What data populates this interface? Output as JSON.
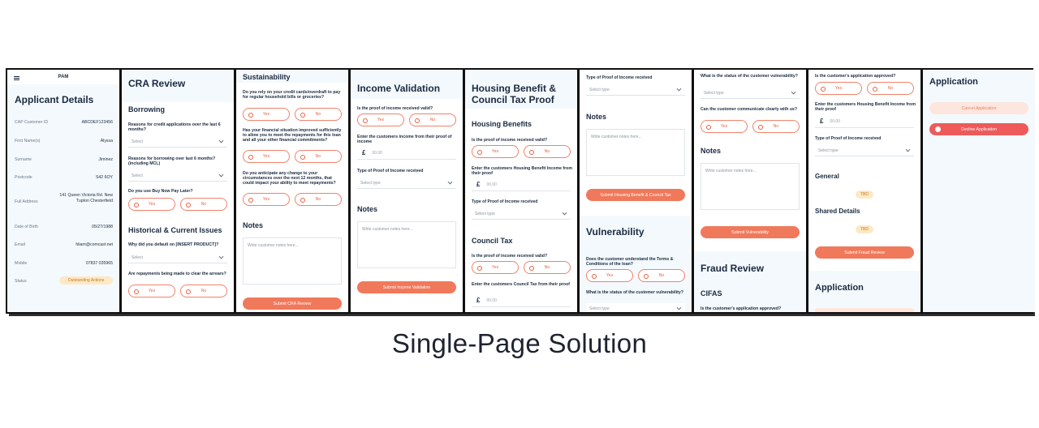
{
  "caption": "Single-Page Solution",
  "panel1": {
    "app_title": "PAM",
    "title": "Applicant Details",
    "rows": [
      {
        "label": "CAP Customer ID",
        "value": "ABCDEF123456"
      },
      {
        "label": "First Name(s)",
        "value": "Alyssa"
      },
      {
        "label": "Surname",
        "value": "Jiminez"
      },
      {
        "label": "Postcode",
        "value": "S42 6OY"
      },
      {
        "label": "Full Address",
        "value": "141 Queen Victoria Rd. New Tupton Chesterfield"
      },
      {
        "label": "Date of Birth",
        "value": "05/27/1988"
      },
      {
        "label": "Email",
        "value": "hliam@comcast.net"
      },
      {
        "label": "Mobile",
        "value": "07837 035965"
      }
    ],
    "status_label": "Status",
    "status_value": "Outstanding Actions"
  },
  "panel2": {
    "title": "CRA Review",
    "section1": "Borrowing",
    "q1": "Reasons for credit applications over the last 6 months?",
    "q1_select": "Select",
    "q2": "Reasons for borrowing over last 6 months? (including MCL)",
    "q2_select": "Select",
    "q3": "Do you use Buy Now Pay Later?",
    "section2": "Historical & Current Issues",
    "q4": "Why did you default on [INSERT PRODUCT]?",
    "q4_select": "Select",
    "q5": "Are repayments being made to clear the arrears?",
    "yes": "Yes",
    "no": "No"
  },
  "panel3": {
    "title": "Sustainability",
    "q1": "Do you rely on your credit cards/overdraft to pay for regular household bills or groceries?",
    "q2": "Has your financial situation improved sufficiently to allow you to meet the repayments for this loan and all your other financial commitments?",
    "q3": "Do you anticipate any change to your circumstances over the next 12 months, that could impact your ability to meet repayments?",
    "notes_title": "Notes",
    "notes_placeholder": "Write customer notes here...",
    "button": "Submit CRA Review",
    "yes": "Yes",
    "no": "No"
  },
  "panel4": {
    "title": "Income Validation",
    "q1": "Is the proof of income received valid?",
    "q2": "Enter the customers income from their proof of income",
    "currency": "£",
    "amount_placeholder": "00.00",
    "q3": "Type of Proof of Income received",
    "select": "Select type",
    "notes_title": "Notes",
    "notes_placeholder": "Write customer notes here...",
    "button": "Submit Income Validation",
    "yes": "Yes",
    "no": "No"
  },
  "panel5": {
    "title": "Housing Benefit & Council Tax Proof",
    "section1": "Housing Benefits",
    "q1": "Is the proof of income received valid?",
    "q2": "Enter the customers Housing Benefit Income from their proof",
    "currency": "£",
    "amount_placeholder": "00.00",
    "q3": "Type of Proof of Income received",
    "select": "Select type",
    "section2": "Council Tax",
    "q4": "Is the proof of income received valid?",
    "q5": "Enter the customers Council Tax from their proof",
    "yes": "Yes",
    "no": "No"
  },
  "panel6": {
    "q1": "Type of Proof of Income received",
    "select": "Select type",
    "notes_title": "Notes",
    "notes_placeholder": "Write customer notes here...",
    "button": "Submit Housing Benefit & Council Tax",
    "section": "Vulnerability",
    "q2": "Does the customer understand the Terms & Conditions of the loan?",
    "q3": "What is the status of the customer vulnerability?",
    "select2": "Select type",
    "yes": "Yes",
    "no": "No"
  },
  "panel7": {
    "q1": "What is the status of the customer vulnerability?",
    "select": "Select type",
    "q2": "Can the customer communicate clearly with us?",
    "notes_title": "Notes",
    "notes_placeholder": "Write customer notes here...",
    "button": "Submit Vulnerability",
    "section": "Fraud Review",
    "sub": "CIFAS",
    "q3": "Is the customer's application approved?",
    "yes": "Yes",
    "no": "No"
  },
  "panel8": {
    "q1": "Is the customer's application approved?",
    "q2": "Enter the customers Housing Benefit Income from their proof",
    "currency": "£",
    "amount_placeholder": "00.00",
    "q3": "Type of Proof of Income received",
    "select": "Select type",
    "general": "General",
    "tbd1": "TBD",
    "shared": "Shared Details",
    "tbd2": "TBD",
    "button": "Submit Fraud Review",
    "section": "Application",
    "yes": "Yes",
    "no": "No"
  },
  "panel9": {
    "title": "Application",
    "cancel": "Cancel Application",
    "decline": "Decline Application"
  }
}
